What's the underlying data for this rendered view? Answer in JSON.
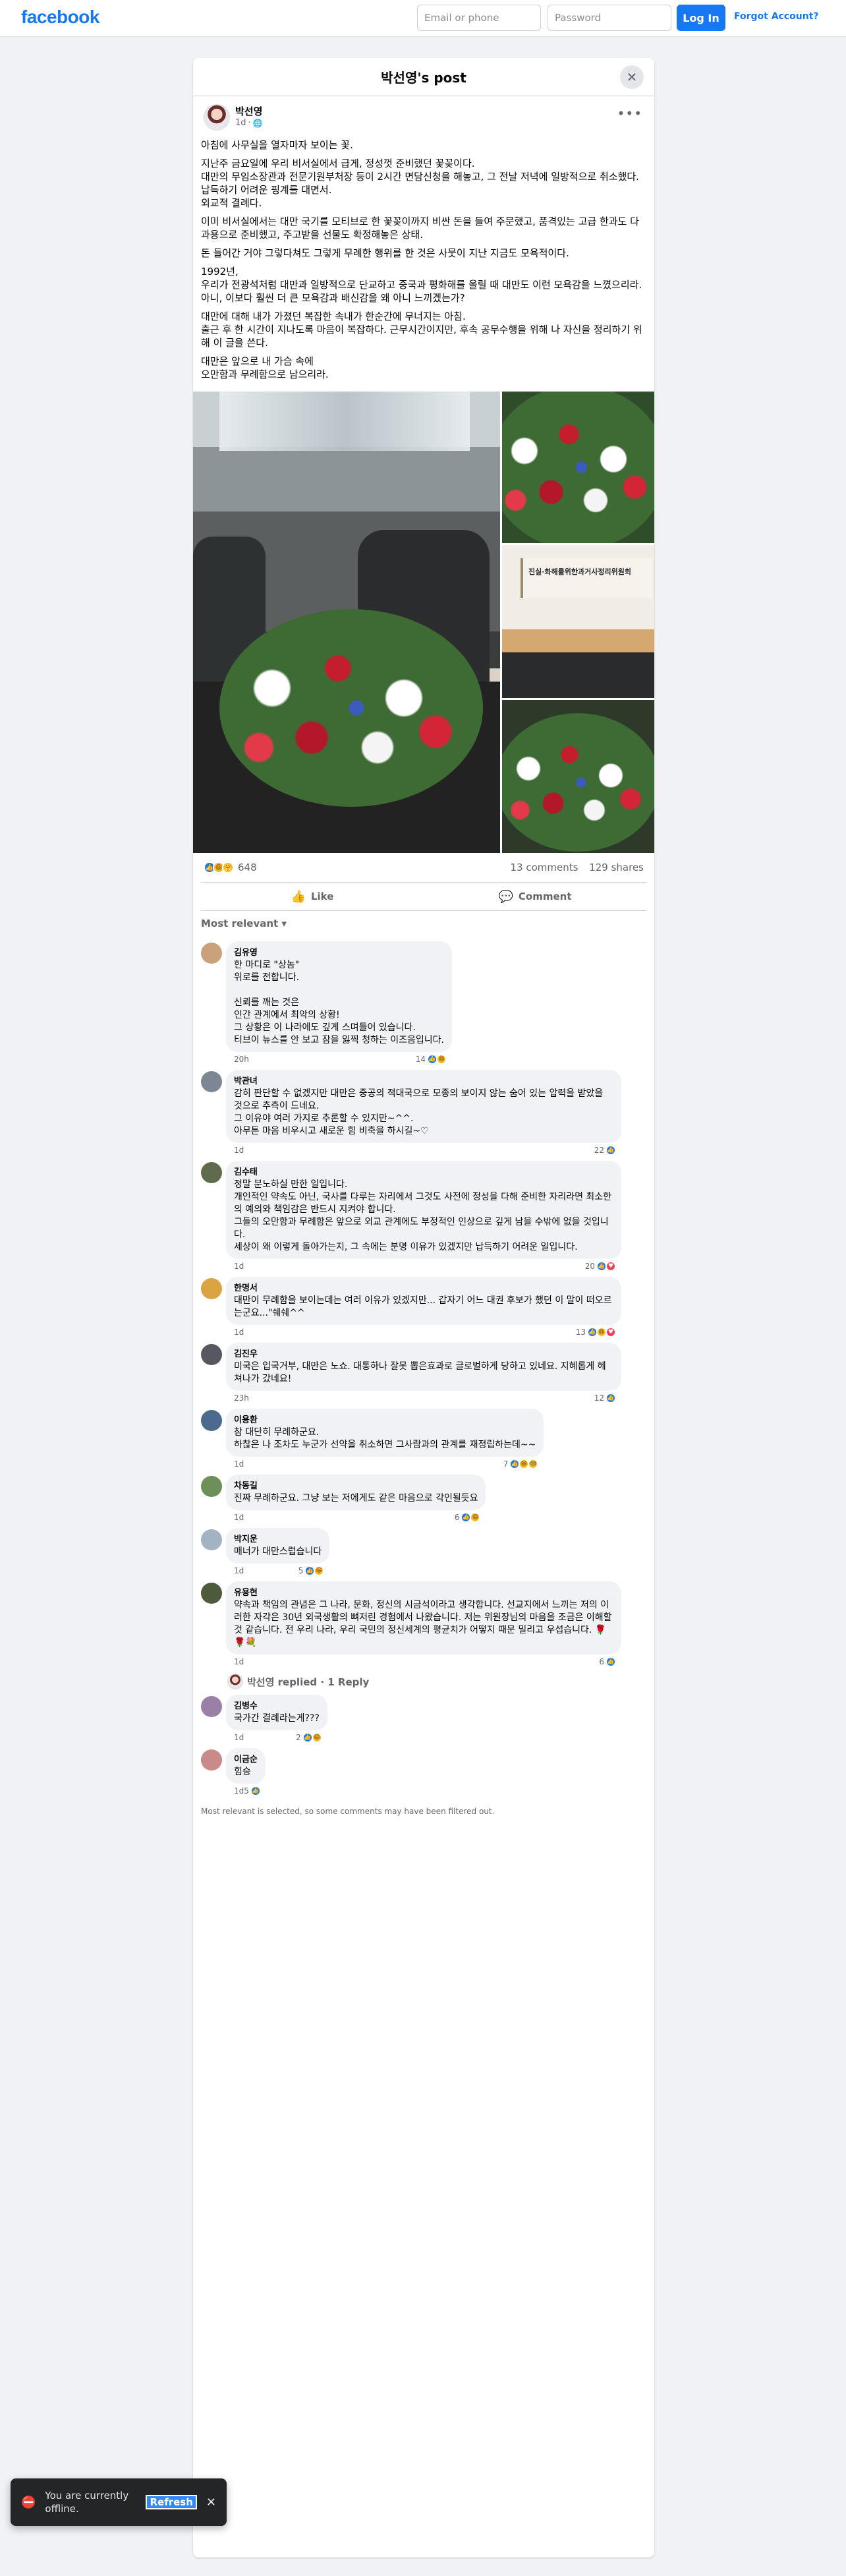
{
  "topbar": {
    "logo": "facebook",
    "email_placeholder": "Email or phone",
    "password_placeholder": "Password",
    "login_label": "Log In",
    "forgot_label": "Forgot Account?"
  },
  "card": {
    "title": "박선영's post",
    "close_icon": "close-icon"
  },
  "post": {
    "author": "박선영",
    "time": "1d",
    "privacy_icon": "globe-icon",
    "paragraphs": [
      "아침에 사무실을 열자마자 보이는 꽃.",
      "지난주 금요일에 우리 비서실에서 급게, 정성껏 준비했던 꽃꽂이다.\n대만의 무임소장관과 전문기원부처장 등이 2시간 면담신청을 해놓고, 그 전날 저녁에 일방적으로 취소했다.\n납득하기 어려운 핑계를 대면서.\n외교적 결례다.",
      "이미 비서실에서는 대만 국기를 모티브로 한 꽃꽂이까지 비싼 돈을 들여 주문했고, 품격있는 고급 한과도 다과용으로 준비했고, 주고받을 선물도 확정해놓은 상태.",
      "돈 들어간 거야 그렇다쳐도 그렇게 무례한 행위를 한 것은 사뭇이 지난 지금도 모욕적이다.",
      "1992년,\n우리가 전광석처럼 대만과 일방적으로 단교하고 중국과 평화해를 올릴 때 대만도 이런 모욕감을 느꼈으리라.\n아니, 이보다 훨씬 더 큰 모욕감과 배신감을 왜 아니 느끼겠는가?",
      "대만에 대해 내가 가졌던 복잡한 속내가 한순간에 무너지는 아침.\n출근 후 한 시간이 지나도록 마음이 복잡하다. 근무시간이지만, 후속 공무수행을 위해 나 자신을 정리하기 위해 이 글을 쓴다.",
      "대만은 앞으로 내 가슴 속에\n오만함과 무례함으로 남으리라."
    ],
    "photo_sign_text": "진실·화해를위한과거사정리위원회",
    "reaction_count": "648",
    "comments_count": "13 comments",
    "shares_count": "129 shares",
    "like_label": "Like",
    "comment_label": "Comment",
    "sort_label": "Most relevant"
  },
  "comments": [
    {
      "name": "김유영",
      "text": "한 마디로 \"상놈\"\n위로를 전합니다.\n\n신뢰를 깨는 것은\n인간 관계에서 최악의 상황!\n그 상황은 이 나라에도 깊게 스며들어 있습니다.\n티브이 뉴스를 안 보고 잠을 잃찍 청하는 이즈음입니다.",
      "time": "20h",
      "reacts": "14"
    },
    {
      "name": "박관녀",
      "text": "감히 판단할 수 없겠지만 대만은 중공의 적대국으로 모종의 보이지 않는 숨어 있는 압력을 받았을 것으로 추측이 드네요.\n그 이유야 여러 가지로 추론할 수 있지만~^^.\n아무튼 마음 비우시고 새로운 힘 비축을 하시길~♡",
      "time": "1d",
      "reacts": "22"
    },
    {
      "name": "김수태",
      "text": "정말 분노하실 만한 일입니다.\n개인적인 약속도 아닌, 국사를 다루는 자리에서 그것도 사전에 정성을 다해 준비한 자리라면 최소한의 예의와 책임감은 반드시 지켜야 합니다.\n그들의 오만함과 무례함은 앞으로 외교 관계에도 부정적인 인상으로 깊게 남을 수밖에 없을 것입니다.\n세상이 왜 이렇게 돌아가는지, 그 속에는 분명 이유가 있겠지만 납득하기 어려운 일입니다.",
      "time": "1d",
      "reacts": "20"
    },
    {
      "name": "한명서",
      "text": "대만이 무례함을 보이는데는 여러 이유가 있겠지만... 갑자기 어느 대권 후보가 했던 이 말이 떠오르는군요...\"쉐쉐^^",
      "time": "1d",
      "reacts": "13"
    },
    {
      "name": "김진우",
      "text": "미국은 입국거부, 대만은 노쇼. 대통하나 잘못 뽑은효과로 글로벌하게 당하고 있네요. 지혜롭게 헤쳐나가 갔네요!",
      "time": "23h",
      "reacts": "12"
    },
    {
      "name": "이용환",
      "text": "참 대단히 무례하군요.\n하찮은 나 조차도 누군가 선약을 취소하면 그사람과의 관계를 재정립하는데~~",
      "time": "1d",
      "reacts": "7"
    },
    {
      "name": "차동길",
      "text": "진짜 무례하군요. 그냥 보는 저에게도 같은 마음으로 각인될듯요",
      "time": "1d",
      "reacts": "6"
    },
    {
      "name": "박지운",
      "text": "매너가 대만스럽습니다",
      "time": "1d",
      "reacts": "5"
    },
    {
      "name": "유용현",
      "text": "약속과 책임의 관념은 그 나라, 문화, 정신의 시금석이라고 생각합니다. 선교지에서 느끼는 저의 이러한 자각은 30년 외국생활의 뼈저린 경험에서 나왔습니다. 저는 위원장님의 마음을 조금은 이해할 것 같습니다. 전 우리 나라, 우리 국민의 정신세계의 평균치가 어떻지 때문 밀리고 우섭습니다. 🌹🌹💐",
      "time": "1d",
      "reacts": "6"
    },
    {
      "name": "김병수",
      "text": "국가간 결례라는게???",
      "time": "1d",
      "reacts": "2"
    },
    {
      "name": "이금순",
      "text": "힘승",
      "time": "1d",
      "reacts": "5"
    }
  ],
  "replied": {
    "text": "박선영 replied · 1 Reply"
  },
  "filter_note": "Most relevant is selected, so some comments may have been filtered out.",
  "toast": {
    "text": "You are currently offline.",
    "refresh_label": "Refresh"
  },
  "colors": {
    "brand": "#1877f2",
    "bg": "#f0f2f5",
    "toast_bg": "#242526"
  }
}
